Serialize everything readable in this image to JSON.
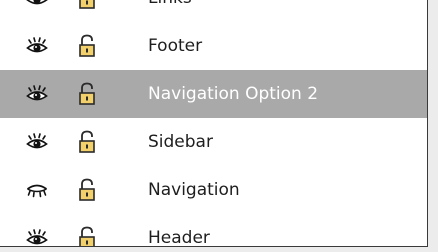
{
  "layers": [
    {
      "name": "Links",
      "visible": true,
      "locked": false,
      "selected": false
    },
    {
      "name": "Footer",
      "visible": true,
      "locked": false,
      "selected": false
    },
    {
      "name": "Navigation Option 2",
      "visible": true,
      "locked": false,
      "selected": true
    },
    {
      "name": "Sidebar",
      "visible": true,
      "locked": false,
      "selected": false
    },
    {
      "name": "Navigation",
      "visible": false,
      "locked": false,
      "selected": false
    },
    {
      "name": "Header",
      "visible": true,
      "locked": false,
      "selected": false
    }
  ],
  "colors": {
    "selected_row": "#a9a9a9",
    "lock_body": "#f2d06b",
    "lock_outline": "#2a2a2a"
  },
  "icons": {
    "visible": "eye-open-icon",
    "hidden": "eye-closed-icon",
    "unlocked": "padlock-open-icon"
  }
}
